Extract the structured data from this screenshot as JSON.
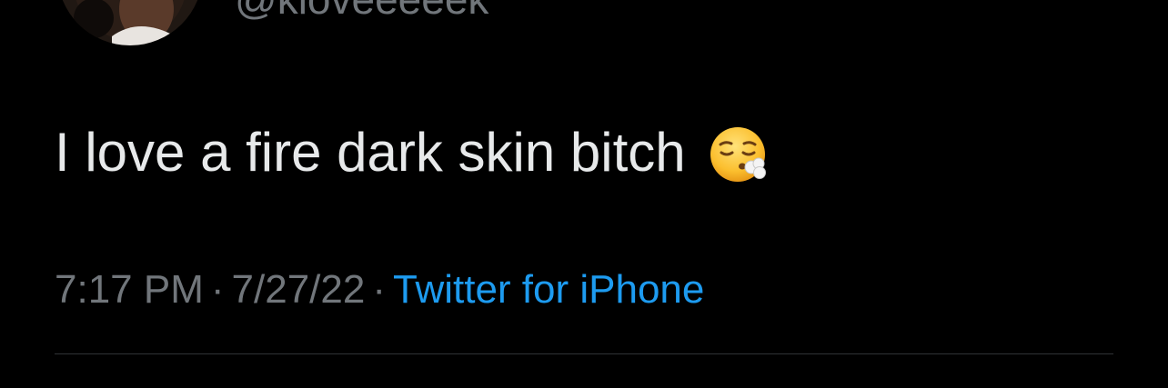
{
  "tweet": {
    "handle": "@kloveeeeek",
    "text": "I love a fire dark skin bitch",
    "emoji": "face-exhaling-emoji",
    "time": "7:17 PM",
    "date": "7/27/22",
    "separator": "·",
    "source": "Twitter for iPhone"
  },
  "colors": {
    "background": "#000000",
    "text": "#e7e9ea",
    "secondary": "#71767b",
    "link": "#1d9bf0",
    "divider": "#2f3336"
  }
}
